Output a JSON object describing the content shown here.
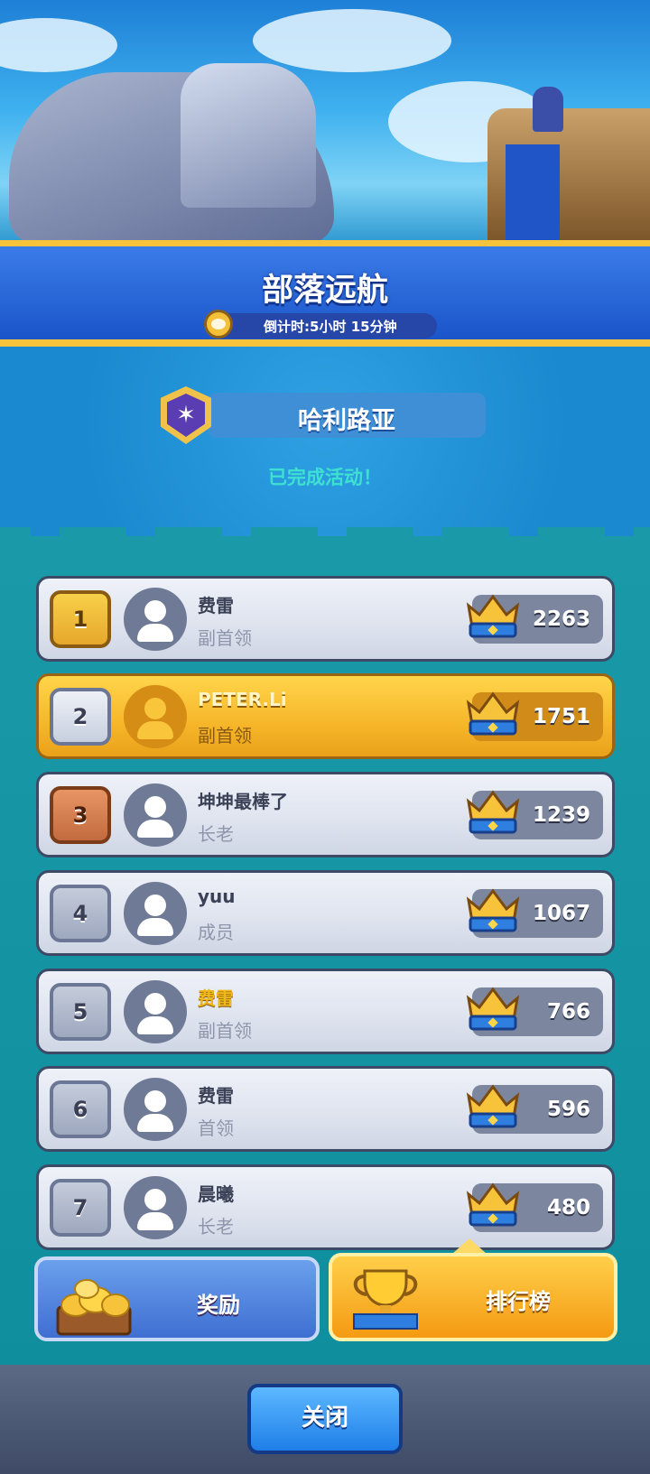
{
  "event": {
    "title": "部落远航",
    "countdown_prefix": "倒计时:",
    "countdown_hours": "5",
    "hours_unit": "小时",
    "countdown_minutes": "15",
    "minutes_unit": "分钟"
  },
  "clan": {
    "name": "哈利路亚",
    "status": "已完成活动！"
  },
  "leaderboard": [
    {
      "rank": "1",
      "name": "费雷",
      "role": "副首领",
      "score": "2263"
    },
    {
      "rank": "2",
      "name": "PETER.Li",
      "role": "副首领",
      "score": "1751"
    },
    {
      "rank": "3",
      "name": "坤坤最棒了",
      "role": "长老",
      "score": "1239"
    },
    {
      "rank": "4",
      "name": "yuu",
      "role": "成员",
      "score": "1067"
    },
    {
      "rank": "5",
      "name": "费雷",
      "role": "副首领",
      "score": "766"
    },
    {
      "rank": "6",
      "name": "费雷",
      "role": "首领",
      "score": "596"
    },
    {
      "rank": "7",
      "name": "晨曦",
      "role": "长老",
      "score": "480"
    }
  ],
  "tabs": {
    "rewards_label": "奖励",
    "ranking_label": "排行榜"
  },
  "close_label": "关闭",
  "colors": {
    "title_band": "#1a55c9",
    "gold_border": "#f6c33b",
    "highlight_row": "#f6b62a",
    "status_text": "#3ee0d2",
    "close_button": "#1f7fe8"
  }
}
